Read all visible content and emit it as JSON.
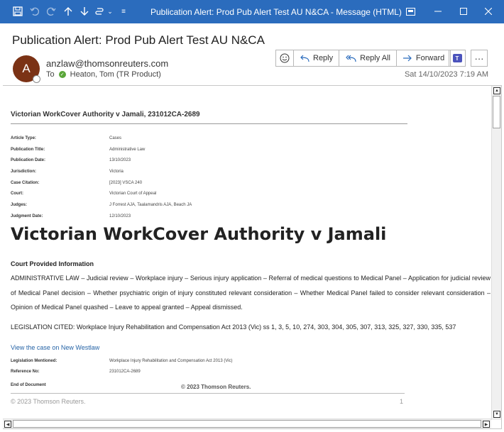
{
  "titlebar": {
    "title": "Publication Alert: Prod Pub Alert Test AU N&CA  -  Message (HTML)",
    "icons": [
      "save-icon",
      "undo-icon",
      "redo-icon",
      "up-arrow-icon",
      "down-arrow-icon",
      "paperclip-icon",
      "more-chevron-icon",
      "customize-icon",
      "window-layout-icon",
      "minimize-icon",
      "maximize-icon",
      "close-icon"
    ]
  },
  "header": {
    "subject": "Publication Alert: Prod Pub Alert Test AU N&CA",
    "avatar_letter": "A",
    "sender": "anzlaw@thomsonreuters.com",
    "to_label": "To",
    "recipient": "Heaton, Tom (TR Product)",
    "date": "Sat 14/10/2023 7:19 AM",
    "actions": {
      "reply": "Reply",
      "reply_all": "Reply All",
      "forward": "Forward"
    }
  },
  "article": {
    "heading": "Victorian WorkCover Authority v Jamali, 231012CA-2689",
    "metadata": [
      {
        "key": "Article Type:",
        "value": "Cases"
      },
      {
        "key": "Publication Title:",
        "value": "Administrative Law"
      },
      {
        "key": "Publication Date:",
        "value": "13/10/2023"
      },
      {
        "key": "Jurisdiction:",
        "value": "Victoria"
      },
      {
        "key": "Case Citation:",
        "value": "[2023] VSCA 240"
      },
      {
        "key": "Court:",
        "value": "Victorian Court of Appeal"
      },
      {
        "key": "Judges:",
        "value": "J Forrest AJA, Taalamandris AJA, Beach JA"
      },
      {
        "key": "Judgment Date:",
        "value": "12/10/2023"
      }
    ],
    "title": "Victorian WorkCover Authority v Jamali",
    "court_info_heading": "Court Provided Information",
    "summary": "ADMINISTRATIVE LAW – Judicial review – Workplace injury – Serious injury application – Referral of medical questions to Medical Panel – Application for judicial review of Medical Panel decision – Whether psychiatric origin of injury constituted relevant consideration – Whether Medical Panel failed to consider relevant consideration – Opinion of Medical Panel quashed – Leave to appeal granted – Appeal dismissed.",
    "legislation_cited": "LEGISLATION CITED: Workplace Injury Rehabilitation and Compensation Act 2013 (Vic) ss 1, 3, 5, 10, 274, 303, 304, 305, 307, 313, 325, 327, 330, 335, 537",
    "westlaw_link": "View the case on New Westlaw",
    "footer_meta": [
      {
        "key": "Legislation Mentioned:",
        "value": "Workplace Injury Rehabilitation and Compensation Act 2013 (Vic)"
      },
      {
        "key": "Reference No:",
        "value": "231012CA-2689"
      }
    ],
    "end_of_document": "End of Document",
    "copyright_bold": "© 2023 Thomson Reuters.",
    "copyright_footer": "© 2023 Thomson Reuters.",
    "page_number": "1"
  }
}
